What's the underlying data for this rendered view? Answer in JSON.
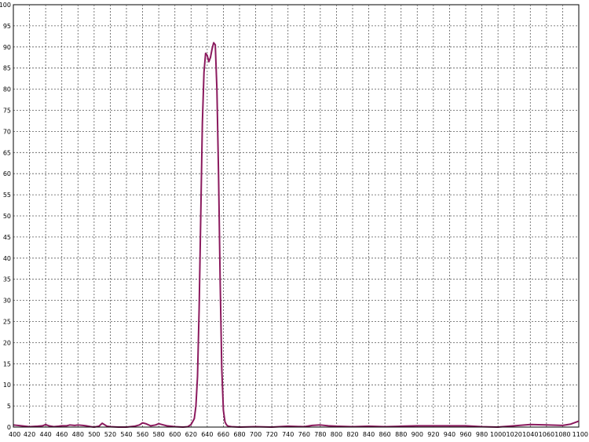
{
  "chart_data": {
    "type": "line",
    "title": "",
    "xlabel": "",
    "ylabel": "",
    "xlim": [
      400,
      1100
    ],
    "ylim": [
      0,
      100
    ],
    "x_ticks": [
      400,
      420,
      440,
      460,
      480,
      500,
      520,
      540,
      560,
      580,
      600,
      620,
      640,
      660,
      680,
      700,
      720,
      740,
      760,
      780,
      800,
      820,
      840,
      860,
      880,
      900,
      920,
      940,
      960,
      980,
      1000,
      1020,
      1040,
      1060,
      1080,
      1100
    ],
    "y_ticks": [
      0,
      5,
      10,
      15,
      20,
      25,
      30,
      35,
      40,
      45,
      50,
      55,
      60,
      65,
      70,
      75,
      80,
      85,
      90,
      95,
      100
    ],
    "grid": true,
    "colors": {
      "series": "#8b1a5e",
      "grid": "#5a5a5a",
      "axis": "#000000"
    },
    "series": [
      {
        "x": [
          400,
          410,
          420,
          430,
          436,
          440,
          444,
          450,
          456,
          460,
          466,
          470,
          476,
          480,
          486,
          490,
          496,
          500,
          506,
          510,
          516,
          520,
          530,
          540,
          550,
          556,
          560,
          564,
          570,
          576,
          580,
          586,
          590,
          600,
          610,
          616,
          620,
          624,
          626,
          628,
          630,
          632,
          634,
          636,
          638,
          640,
          642,
          644,
          646,
          648,
          650,
          652,
          654,
          656,
          658,
          660,
          662,
          664,
          666,
          670,
          680,
          700,
          720,
          740,
          760,
          770,
          780,
          790,
          800,
          820,
          840,
          860,
          880,
          900,
          920,
          940,
          960,
          980,
          1000,
          1020,
          1040,
          1060,
          1080,
          1090,
          1100
        ],
        "y": [
          0.5,
          0.3,
          0.1,
          0.2,
          0.3,
          0.6,
          0.3,
          0.1,
          0.2,
          0.3,
          0.3,
          0.5,
          0.4,
          0.5,
          0.4,
          0.3,
          0.1,
          0.0,
          0.2,
          0.9,
          0.2,
          0.1,
          0.0,
          0.0,
          0.2,
          0.5,
          1.0,
          0.8,
          0.3,
          0.5,
          0.8,
          0.5,
          0.3,
          0.1,
          0.0,
          0.1,
          0.6,
          2.0,
          5.0,
          12.0,
          28.0,
          50.0,
          72.0,
          84.0,
          88.5,
          88.0,
          86.5,
          87.5,
          89.5,
          91.0,
          90.5,
          80.0,
          60.0,
          35.0,
          14.0,
          4.0,
          1.2,
          0.5,
          0.2,
          0.1,
          0.0,
          0.1,
          0.0,
          0.2,
          0.1,
          0.4,
          0.5,
          0.3,
          0.2,
          0.1,
          0.2,
          0.1,
          0.2,
          0.3,
          0.3,
          0.3,
          0.3,
          0.1,
          0.0,
          0.3,
          0.6,
          0.5,
          0.4,
          0.7,
          1.4
        ]
      }
    ]
  }
}
